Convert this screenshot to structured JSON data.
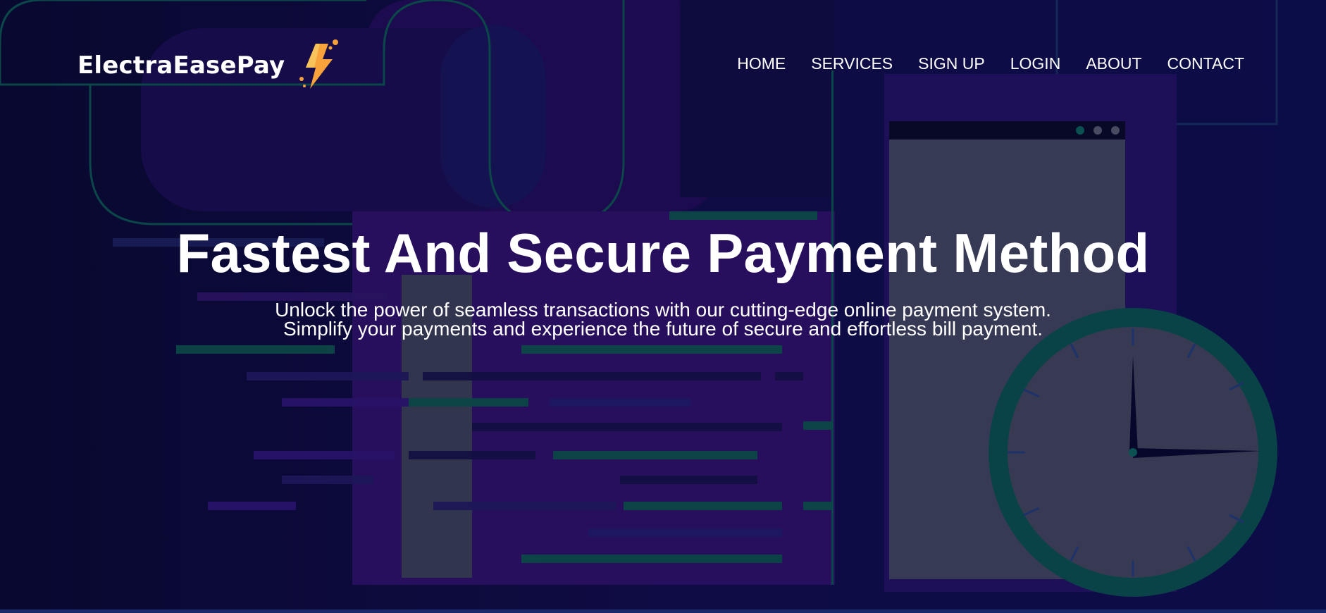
{
  "brand": {
    "name": "ElectraEasePay",
    "logo_icon": "lightning-bolt-icon"
  },
  "nav": {
    "items": [
      {
        "label": "HOME"
      },
      {
        "label": "SERVICES"
      },
      {
        "label": "SIGN UP"
      },
      {
        "label": "LOGIN"
      },
      {
        "label": "ABOUT"
      },
      {
        "label": "CONTACT"
      }
    ]
  },
  "hero": {
    "title": "Fastest And Secure Payment Method",
    "subtitle_line1": "Unlock the power of seamless transactions with our cutting-edge online payment system.",
    "subtitle_line2": "Simplify your payments and experience the future of secure and effortless bill payment."
  },
  "colors": {
    "background": "#0d0c3e",
    "text": "#ffffff",
    "accent_green": "#0e7a66",
    "accent_purple": "#4a1a9e",
    "bolt_orange": "#f7a23b"
  }
}
